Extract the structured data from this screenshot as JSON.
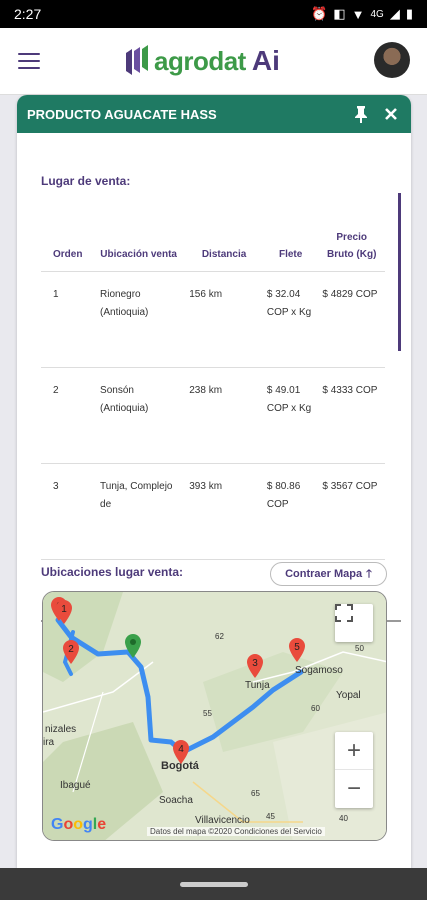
{
  "status_bar": {
    "time": "2:27",
    "network": "4G"
  },
  "app_bar": {
    "logo_text": "agrodat",
    "logo_ai": "Ai"
  },
  "card": {
    "title": "PRODUCTO AGUACATE HASS",
    "section_sale": "Lugar de venta:",
    "section_map": "Ubicaciones lugar venta:",
    "map_button": "Contraer Mapa"
  },
  "table": {
    "headers": [
      "Orden",
      "Ubicación venta",
      "Distancia",
      "Flete",
      "Precio Bruto (Kg)"
    ],
    "rows": [
      {
        "orden": "1",
        "ubicacion": "Rionegro (Antioquia)",
        "distancia": "156 km",
        "flete": "$ 32.04 COP x Kg",
        "precio": "$ 4829 COP"
      },
      {
        "orden": "2",
        "ubicacion": "Sonsón (Antioquia)",
        "distancia": "238 km",
        "flete": "$ 49.01 COP x Kg",
        "precio": "$ 4333 COP"
      },
      {
        "orden": "3",
        "ubicacion": "Tunja, Complejo de",
        "distancia": "393 km",
        "flete": "$ 80.86 COP",
        "precio": "$ 3567 COP"
      }
    ]
  },
  "map": {
    "places": [
      "nizales",
      "ira",
      "Ibagué",
      "Bogotá",
      "Soacha",
      "Villavicencio",
      "Tunja",
      "Sogamoso",
      "Yopal"
    ],
    "markers": [
      "1",
      "2",
      "3",
      "4",
      "5",
      "6"
    ],
    "road_numbers": [
      "62",
      "50",
      "60",
      "55",
      "65",
      "40",
      "45"
    ],
    "credit": "Datos del mapa ©2020   Condiciones del Servicio",
    "google": "Google",
    "zoom_in": "+",
    "zoom_out": "−"
  },
  "colors": {
    "header": "#1f7a63",
    "accent": "#4d3a7a",
    "route": "#3d8ef0",
    "marker": "#e94b3c",
    "origin_marker": "#3aa04a"
  }
}
